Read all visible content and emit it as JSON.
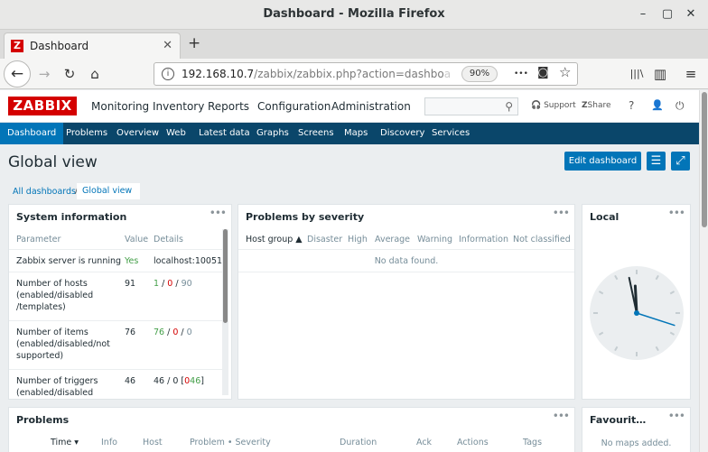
{
  "window": {
    "title": "Dashboard - Mozilla Firefox",
    "min": "–",
    "max": "▢",
    "close": "✕"
  },
  "tab": {
    "favicon": "Z",
    "label": "Dashboard",
    "close": "✕",
    "new": "+"
  },
  "nav": {
    "back": "←",
    "forward": "→",
    "reload": "↻",
    "home": "⌂",
    "url_host": "192.168.10.7",
    "url_path": "/zabbix/zabbix.php?action=dashbo",
    "url_fade": "a",
    "zoom": "90%",
    "more": "•••",
    "pocket": "◙",
    "star": "☆",
    "library": "|||\\",
    "sidebar": "▥",
    "menu": "≡"
  },
  "zabbix": {
    "logo": "ZABBIX",
    "menu": [
      "Monitoring",
      "Inventory",
      "Reports",
      "Configuration",
      "Administration"
    ],
    "search_icon": "⚲",
    "support": "Support",
    "share": "Share",
    "help": "?",
    "user": "👤",
    "logout": "⏻",
    "submenu": [
      "Dashboard",
      "Problems",
      "Overview",
      "Web",
      "Latest data",
      "Graphs",
      "Screens",
      "Maps",
      "Discovery",
      "Services"
    ]
  },
  "page": {
    "title": "Global view",
    "edit_button": "Edit dashboard",
    "list_icon": "☰",
    "fullscreen_icon": "⤢",
    "breadcrumbs": [
      "All dashboards",
      "Global view"
    ],
    "crumb_sep": "/"
  },
  "widgets": {
    "dots": "•••",
    "sysinfo": {
      "title": "System information",
      "headers": [
        "Parameter",
        "Value",
        "Details"
      ],
      "rows": [
        {
          "param": "Zabbix server is running",
          "value": "Yes",
          "details": "localhost:10051"
        },
        {
          "param": "Number of hosts (enabled/disabled /templates)",
          "value": "91",
          "d1": "1",
          "d2": "0",
          "d3": "90",
          "sep": " / "
        },
        {
          "param": "Number of items (enabled/disabled/not supported)",
          "value": "76",
          "d1": "76",
          "d2": "0",
          "d3": "0",
          "sep": " / "
        },
        {
          "param": "Number of triggers (enabled/disabled",
          "value": "46",
          "pre": "46 / 0 [",
          "d2": "0",
          "d3": "46",
          "post": "]"
        }
      ]
    },
    "severity": {
      "title": "Problems by severity",
      "headers": [
        "Host group ▲",
        "Disaster",
        "High",
        "Average",
        "Warning",
        "Information",
        "Not classified"
      ],
      "empty": "No data found."
    },
    "local": {
      "title": "Local",
      "hours": 11.9,
      "minutes": 58,
      "seconds": 18
    },
    "problems": {
      "title": "Problems",
      "headers": [
        "Time ▾",
        "Info",
        "Host",
        "Problem • Severity",
        "Duration",
        "Ack",
        "Actions",
        "Tags"
      ]
    },
    "favourite": {
      "title": "Favourit…",
      "empty": "No maps added."
    }
  }
}
